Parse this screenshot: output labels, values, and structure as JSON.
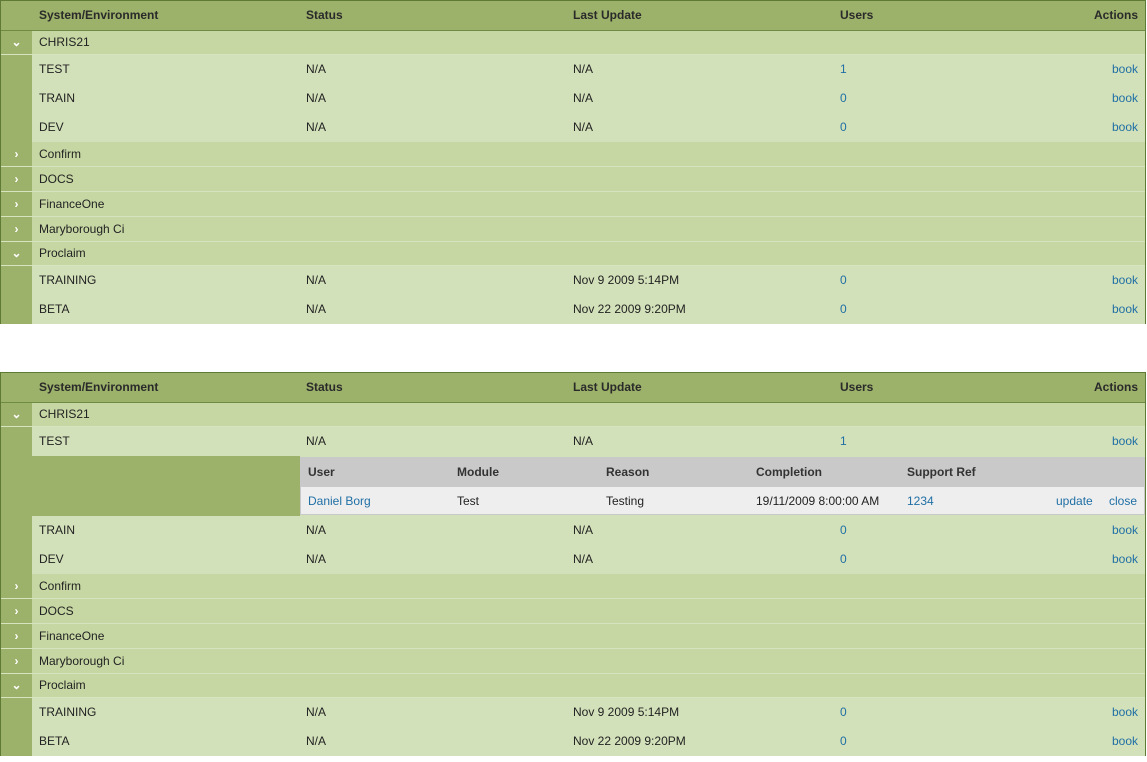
{
  "columns": {
    "system": "System/Environment",
    "status": "Status",
    "last_update": "Last Update",
    "users": "Users",
    "actions": "Actions"
  },
  "icons": {
    "expanded": "chevron-down-icon",
    "collapsed": "chevron-right-icon"
  },
  "colors": {
    "header": "#9cb16a",
    "row": "#d3e1ba",
    "group": "#c6d7a3",
    "link": "#1f6fa5"
  },
  "grid1": {
    "chris21": {
      "name": "CHRIS21",
      "envs": [
        {
          "name": "TEST",
          "status": "N/A",
          "updated": "N/A",
          "users": "1",
          "action": "book"
        },
        {
          "name": "TRAIN",
          "status": "N/A",
          "updated": "N/A",
          "users": "0",
          "action": "book"
        },
        {
          "name": "DEV",
          "status": "N/A",
          "updated": "N/A",
          "users": "0",
          "action": "book"
        }
      ]
    },
    "groups": [
      "Confirm",
      "DOCS",
      "FinanceOne",
      "Maryborough Ci"
    ],
    "proclaim": {
      "name": "Proclaim",
      "envs": [
        {
          "name": "TRAINING",
          "status": "N/A",
          "updated": "Nov 9 2009 5:14PM",
          "users": "0",
          "action": "book"
        },
        {
          "name": "BETA",
          "status": "N/A",
          "updated": "Nov 22 2009 9:20PM",
          "users": "0",
          "action": "book"
        }
      ]
    }
  },
  "grid2": {
    "chris21": {
      "name": "CHRIS21",
      "envs": [
        {
          "name": "TEST",
          "status": "N/A",
          "updated": "N/A",
          "users": "1",
          "action": "book"
        },
        {
          "name": "TRAIN",
          "status": "N/A",
          "updated": "N/A",
          "users": "0",
          "action": "book"
        },
        {
          "name": "DEV",
          "status": "N/A",
          "updated": "N/A",
          "users": "0",
          "action": "book"
        }
      ]
    },
    "booking": {
      "headers": {
        "user": "User",
        "module": "Module",
        "reason": "Reason",
        "completion": "Completion",
        "ref": "Support Ref"
      },
      "row": {
        "user": "Daniel Borg",
        "module": "Test",
        "reason": "Testing",
        "completion": "19/11/2009 8:00:00 AM",
        "ref": "1234",
        "update": "update",
        "close": "close"
      }
    },
    "groups": [
      "Confirm",
      "DOCS",
      "FinanceOne",
      "Maryborough Ci"
    ],
    "proclaim": {
      "name": "Proclaim",
      "envs": [
        {
          "name": "TRAINING",
          "status": "N/A",
          "updated": "Nov 9 2009 5:14PM",
          "users": "0",
          "action": "book"
        },
        {
          "name": "BETA",
          "status": "N/A",
          "updated": "Nov 22 2009 9:20PM",
          "users": "0",
          "action": "book"
        }
      ]
    }
  }
}
